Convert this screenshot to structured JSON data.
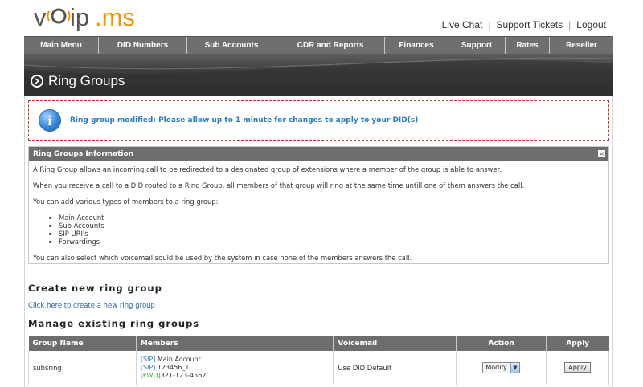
{
  "logo": {
    "text": "voip.ms"
  },
  "toplinks": [
    {
      "label": "Live Chat"
    },
    {
      "label": "Support Tickets"
    },
    {
      "label": "Logout"
    }
  ],
  "nav": [
    {
      "label": "Main Menu"
    },
    {
      "label": "DID Numbers"
    },
    {
      "label": "Sub Accounts"
    },
    {
      "label": "CDR and Reports"
    },
    {
      "label": "Finances"
    },
    {
      "label": "Support"
    },
    {
      "label": "Rates"
    },
    {
      "label": "Reseller"
    }
  ],
  "page_title": "Ring Groups",
  "notice": {
    "message": "Ring group modified: Please allow up to 1 minute for changes to apply to your DID(s)"
  },
  "info_panel": {
    "title": "Ring Groups Information",
    "p1": "A Ring Group allows an incoming call to be redirected to a designated group of extensions where a member of the group is able to answer.",
    "p2": "When you receive a call to a DID routed to a Ring Group, all members of that group will ring at the same time untill one of them answers the call.",
    "p3": "You can add various types of members to a ring group:",
    "items": [
      "Main Account",
      "Sub Accounts",
      "SIP URI's",
      "Forwardings"
    ],
    "p4": "You can also select which voicemail sould be used by the system in case none of the members answers the call."
  },
  "create": {
    "heading": "Create new ring group",
    "link": "Click here to create a new ring group"
  },
  "manage": {
    "heading": "Manage existing ring groups",
    "columns": [
      "Group Name",
      "Members",
      "Voicemail",
      "Action",
      "Apply"
    ],
    "rows": [
      {
        "name": "subsring",
        "members": [
          {
            "tag": "[SIP]",
            "value": " Main Account"
          },
          {
            "tag": "[SIP]",
            "value": " 123456_1"
          },
          {
            "tag": "[FWD]",
            "value": "321-123-4567"
          }
        ],
        "voicemail": "Use DID Default",
        "action": "Modify",
        "apply": "Apply"
      }
    ]
  },
  "colors": {
    "nav_bg": "#6f6f6f",
    "link": "#2a5ea0",
    "notice_text": "#2b7cc0",
    "logo_orange": "#f39200"
  }
}
